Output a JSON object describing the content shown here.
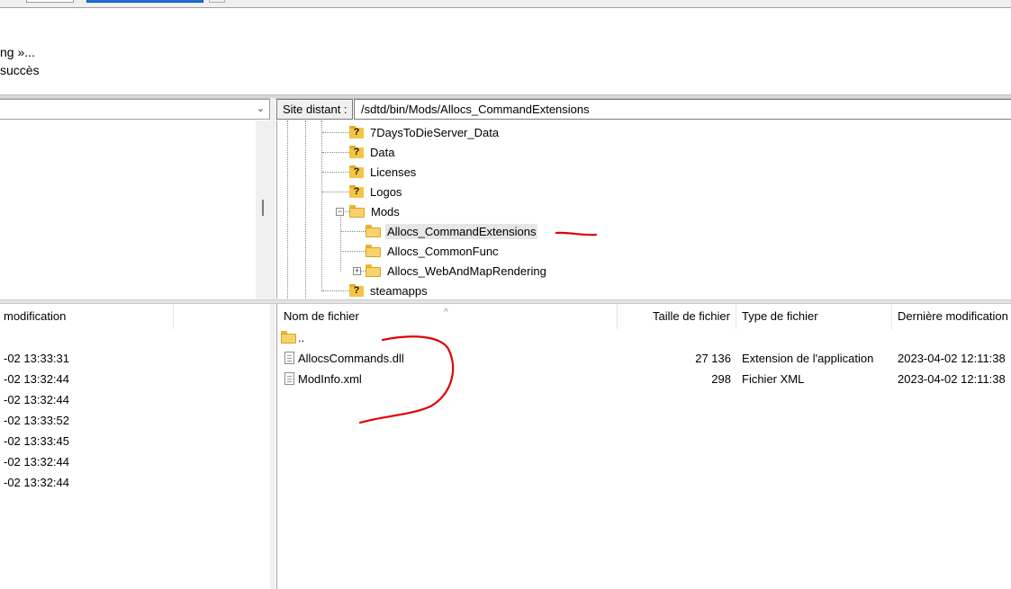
{
  "log": {
    "lines": [
      "ng »...",
      " succès"
    ]
  },
  "left_panel": {
    "dropdown_arrow": "⌄",
    "columns": {
      "modified": "modification"
    },
    "rows": [
      {
        "modified": "-02 13:33:31"
      },
      {
        "modified": "-02 13:32:44"
      },
      {
        "modified": "-02 13:32:44"
      },
      {
        "modified": "-02 13:33:52"
      },
      {
        "modified": "-02 13:33:45"
      },
      {
        "modified": "-02 13:32:44"
      },
      {
        "modified": "-02 13:32:44"
      }
    ]
  },
  "remote": {
    "site_label": "Site distant :",
    "path": "/sdtd/bin/Mods/Allocs_CommandExtensions",
    "tree": [
      {
        "label": "7DaysToDieServer_Data",
        "icon": "unknown-folder-icon"
      },
      {
        "label": "Data",
        "icon": "unknown-folder-icon"
      },
      {
        "label": "Licenses",
        "icon": "unknown-folder-icon"
      },
      {
        "label": "Logos",
        "icon": "unknown-folder-icon"
      },
      {
        "label": "Mods",
        "icon": "folder-icon"
      },
      {
        "label": "Allocs_CommandExtensions",
        "icon": "folder-icon",
        "selected": true
      },
      {
        "label": "Allocs_CommonFunc",
        "icon": "folder-icon"
      },
      {
        "label": "Allocs_WebAndMapRendering",
        "icon": "folder-icon"
      },
      {
        "label": "steamapps",
        "icon": "unknown-folder-icon"
      }
    ],
    "columns": {
      "name": "Nom de fichier",
      "size": "Taille de fichier",
      "type": "Type de fichier",
      "modified": "Dernière modification"
    },
    "sort_indicator": "^",
    "files": [
      {
        "name": "..",
        "size": "",
        "type": "",
        "modified": "",
        "icon": "folder-icon"
      },
      {
        "name": "AllocsCommands.dll",
        "size": "27 136",
        "type": "Extension de l'application",
        "modified": "2023-04-02 12:11:38",
        "icon": "dll-file-icon"
      },
      {
        "name": "ModInfo.xml",
        "size": "298",
        "type": "Fichier XML",
        "modified": "2023-04-02 12:11:38",
        "icon": "xml-file-icon"
      }
    ]
  },
  "colors": {
    "annotation": "#e00000",
    "selection": "#e6e6e6",
    "folder": "#f8d26a",
    "accent_button": "#1e6fd1"
  }
}
